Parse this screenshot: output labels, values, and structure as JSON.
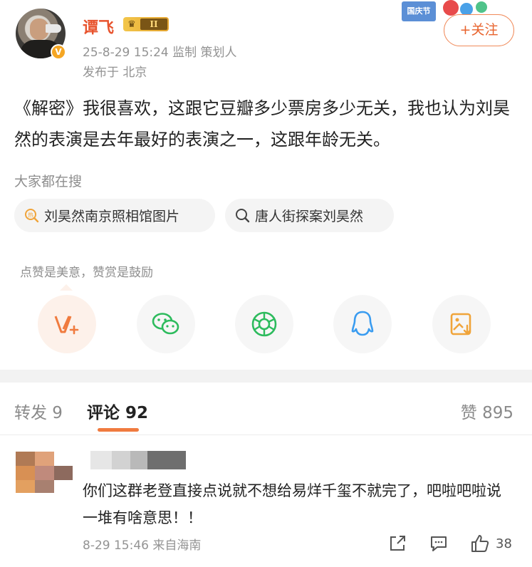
{
  "author": {
    "name": "谭飞",
    "level_badge": "II",
    "verified_badge": "V",
    "time_and_roles": "25-8-29 15:24  监制 策划人",
    "location": "发布于 北京",
    "follow_label": "+关注",
    "festival_badge": "国庆节"
  },
  "post": {
    "text": "《解密》我很喜欢，这跟它豆瓣多少票房多少无关，我也认为刘昊然的表演是去年最好的表演之一，这跟年龄无关。"
  },
  "search": {
    "title": "大家都在搜",
    "items": [
      {
        "label": "刘昊然南京照相馆图片",
        "icon": "hot-search-icon"
      },
      {
        "label": "唐人街探案刘昊然",
        "icon": "search-icon"
      }
    ]
  },
  "reward": {
    "label": "点赞是美意，赞赏是鼓励"
  },
  "share": {
    "buttons": [
      "reward-icon",
      "wechat-icon",
      "moments-icon",
      "qq-icon",
      "save-image-icon"
    ]
  },
  "tabs": {
    "forward": "转发 9",
    "comments": "评论 92",
    "likes": "赞 895"
  },
  "comment": {
    "text": "你们这群老登直接点说就不想给易烊千玺不就完了，吧啦吧啦说一堆有啥意思！！",
    "meta": "8-29 15:46  来自海南",
    "like_count": "38"
  },
  "colors": {
    "accent": "#f07b3f",
    "username": "#e8532d",
    "wechat": "#2dbb5d",
    "qq": "#3a9cf0",
    "save": "#f0a43a"
  }
}
